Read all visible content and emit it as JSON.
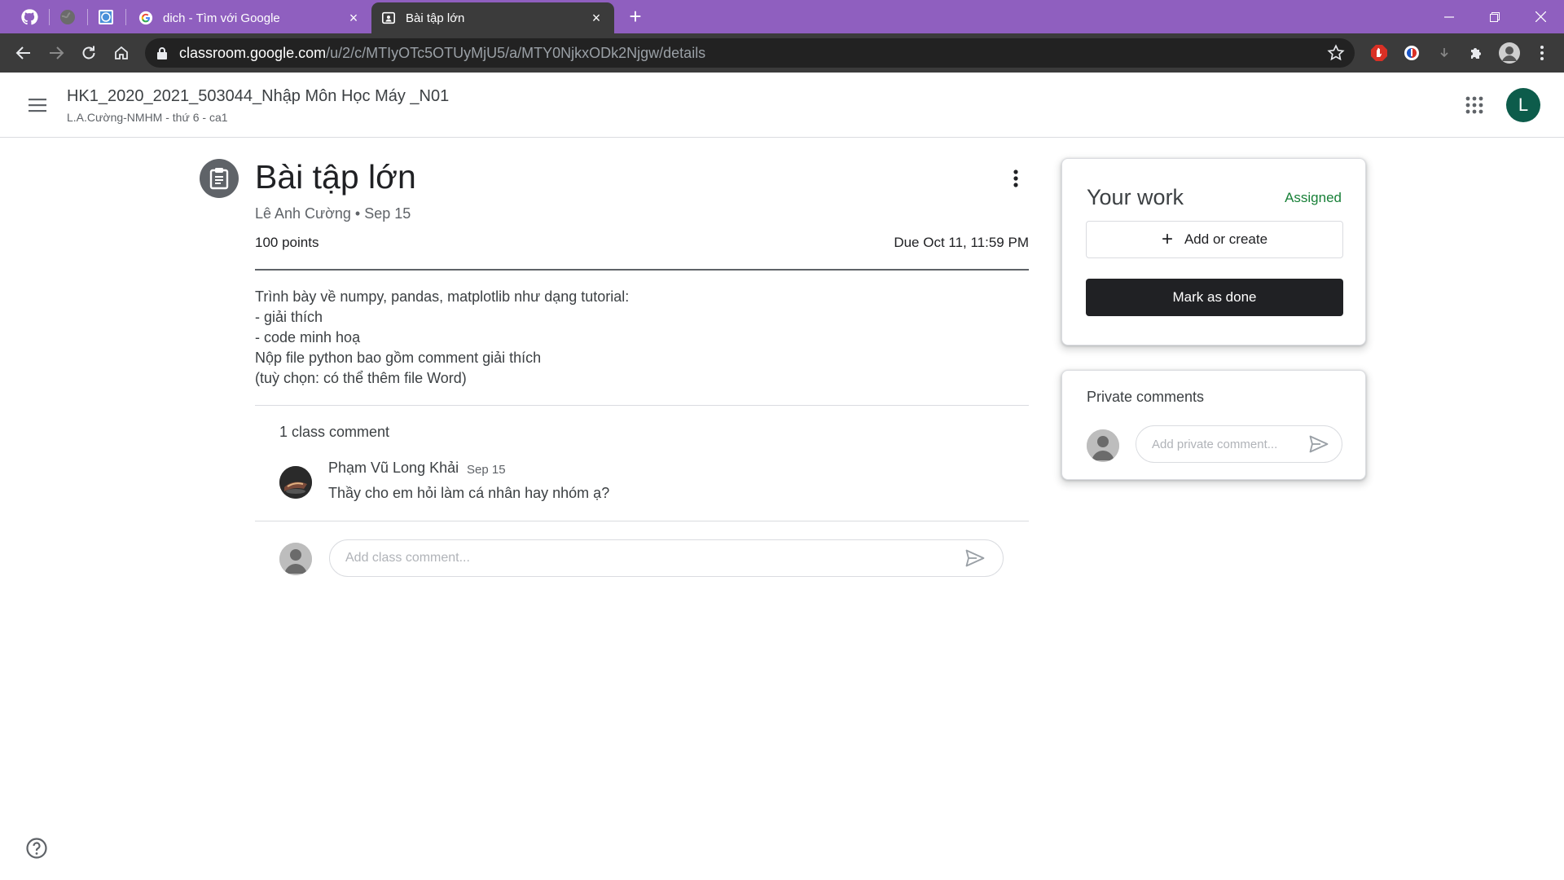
{
  "browser": {
    "tabs": [
      {
        "title": "dich - Tìm với Google",
        "close": "×"
      },
      {
        "title": "Bài tập lớn",
        "close": "×"
      }
    ],
    "new_tab": "+",
    "url_host": "classroom.google.com",
    "url_path": "/u/2/c/MTIyOTc5OTUyMjU5/a/MTY0NjkxODk2Njgw/details"
  },
  "header": {
    "class_title": "HK1_2020_2021_503044_Nhập Môn Học Máy _N01",
    "class_subtitle": "L.A.Cường-NMHM - thứ 6 - ca1",
    "account_initial": "L"
  },
  "assignment": {
    "title": "Bài tập lớn",
    "meta": "Lê Anh Cường • Sep 15",
    "points": "100 points",
    "due": "Due Oct 11, 11:59 PM",
    "description": [
      "Trình bày về numpy, pandas, matplotlib như dạng tutorial:",
      "- giải thích",
      "- code minh hoạ",
      "Nộp file python bao gồm comment giải thích",
      "(tuỳ chọn: có thể thêm file Word)"
    ]
  },
  "class_comments": {
    "count_label": "1 class comment",
    "items": [
      {
        "author": "Phạm Vũ Long Khải",
        "date": "Sep 15",
        "text": "Thầy cho em hỏi làm cá nhân hay nhóm ạ?"
      }
    ],
    "input_placeholder": "Add class comment..."
  },
  "your_work": {
    "title": "Your work",
    "status": "Assigned",
    "add_label": "Add or create",
    "done_label": "Mark as done"
  },
  "private_comments": {
    "title": "Private comments",
    "input_placeholder": "Add private comment..."
  },
  "colors": {
    "tabbar": "#8f5fbf",
    "toolbar": "#3b3b3b",
    "status_green": "#188038",
    "primary_button": "#202124",
    "account": "#0d5c4b"
  },
  "icons": [
    "github-icon",
    "globe-icon",
    "translate-icon",
    "google-icon",
    "classroom-icon",
    "back-icon",
    "forward-icon",
    "reload-icon",
    "home-icon",
    "lock-icon",
    "star-icon",
    "menu-icon",
    "apps-icon",
    "assignment-icon",
    "more-vert-icon",
    "send-icon",
    "help-icon"
  ]
}
